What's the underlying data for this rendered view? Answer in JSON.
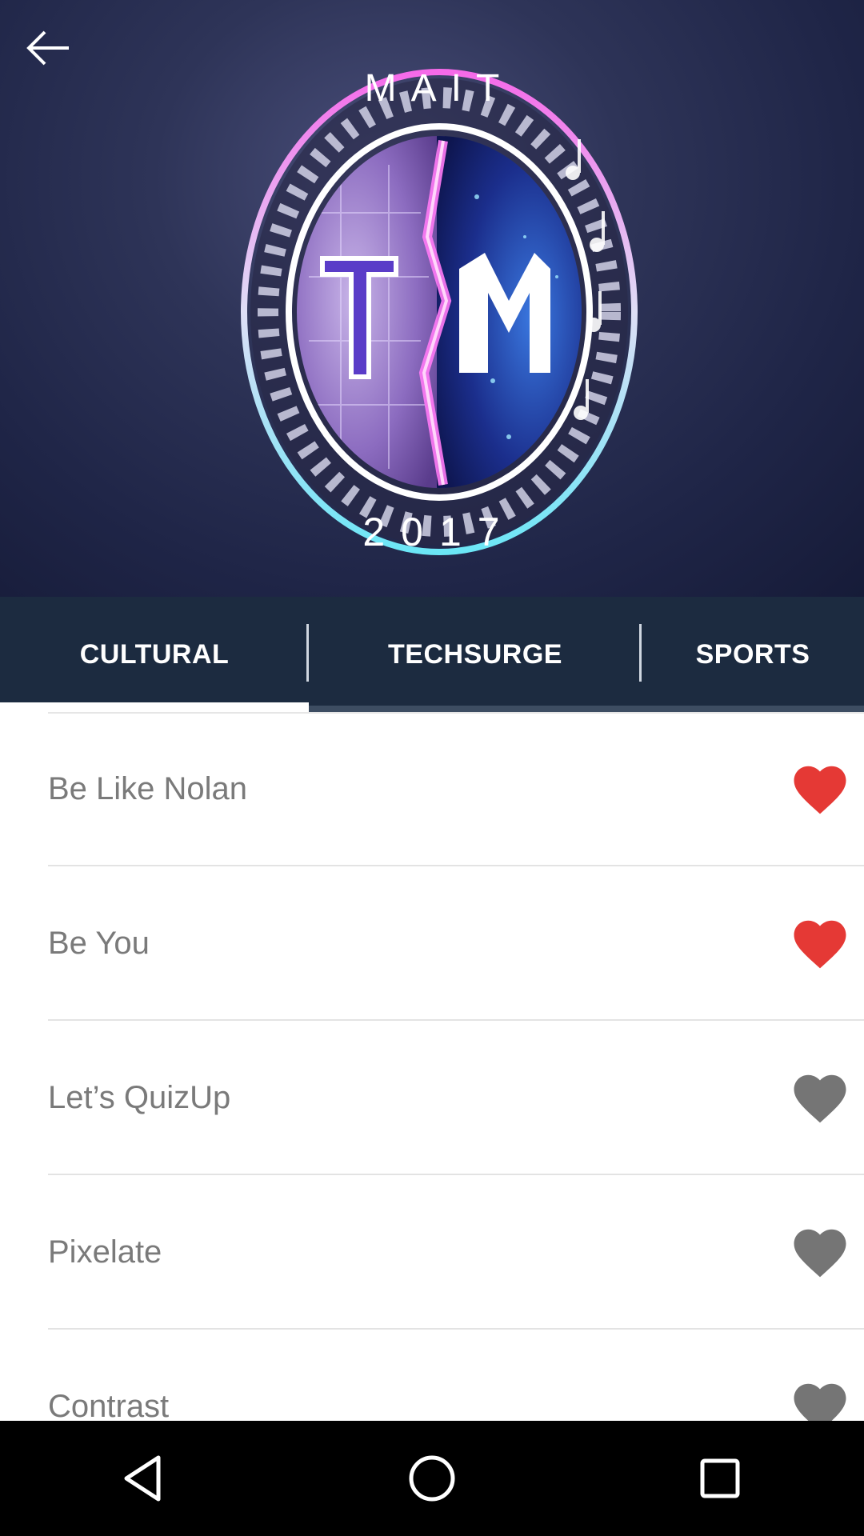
{
  "header": {
    "logo": {
      "top_text": "MAIT",
      "year_text": "2017",
      "monogram": "TM"
    },
    "back_icon": "arrow-left-icon"
  },
  "tabs": [
    {
      "label": "CULTURAL",
      "selected": true
    },
    {
      "label": "TECHSURGE",
      "selected": false
    },
    {
      "label": "SPORTS",
      "selected": false
    }
  ],
  "events": [
    {
      "name": "Be Like Nolan",
      "favorite": true
    },
    {
      "name": "Be You",
      "favorite": true
    },
    {
      "name": "Let’s QuizUp",
      "favorite": false
    },
    {
      "name": "Pixelate",
      "favorite": false
    },
    {
      "name": "Contrast",
      "favorite": false
    }
  ],
  "colors": {
    "tab_bar": "#1c2b40",
    "heart_favorite": "#e53935",
    "heart_default": "#757575",
    "label_text": "#7a7a7a"
  },
  "navbar": {
    "back": "nav-back-icon",
    "home": "nav-home-icon",
    "recents": "nav-recents-icon"
  }
}
